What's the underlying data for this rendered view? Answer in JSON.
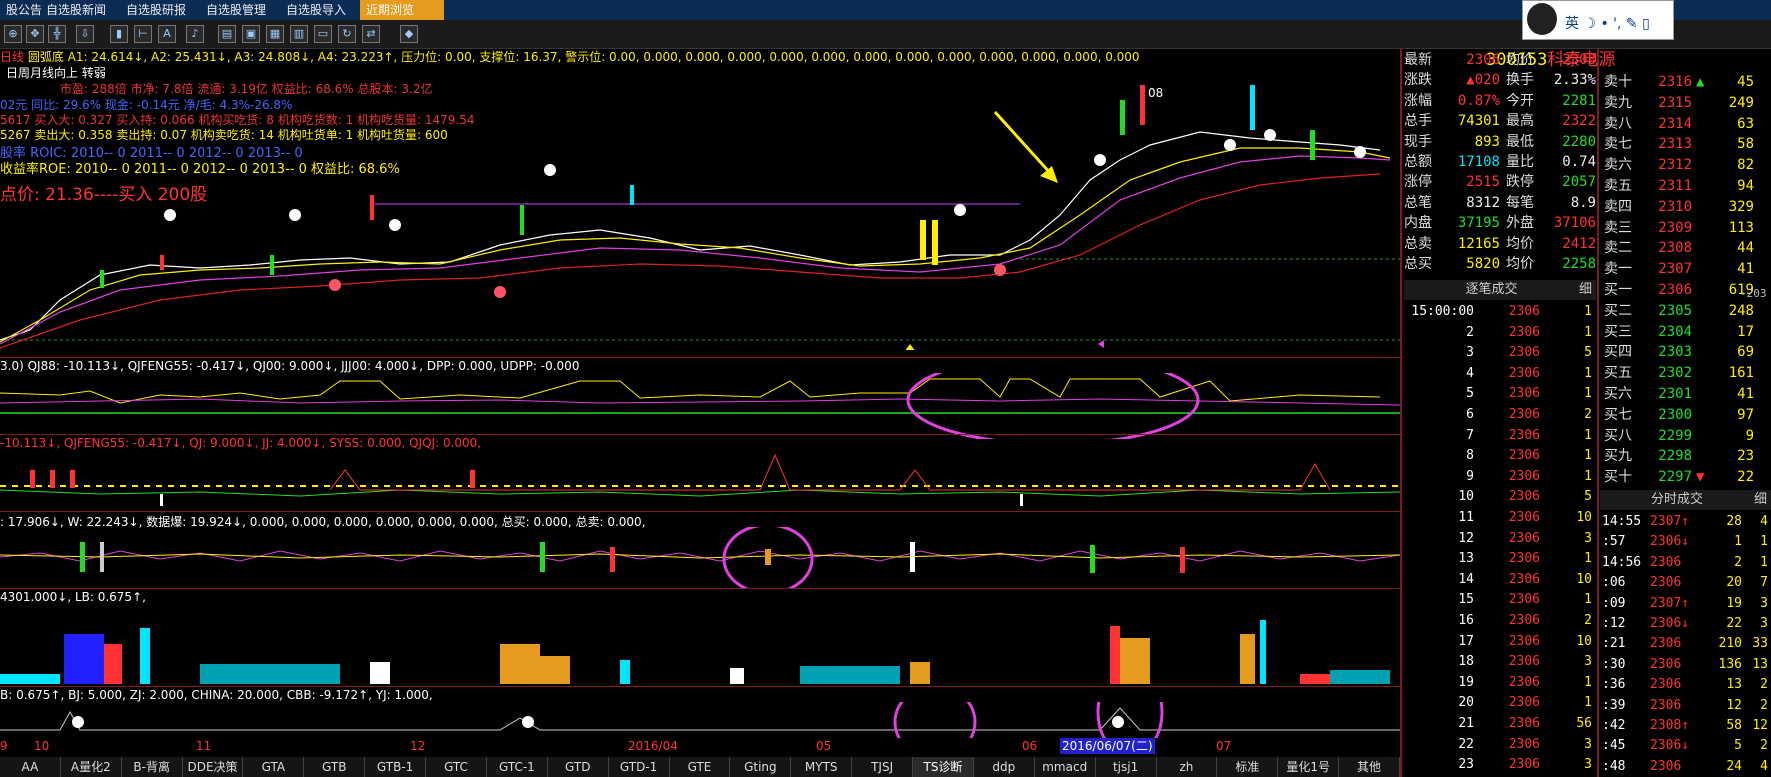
{
  "top_tabs": [
    "股公告",
    "自选股新闻",
    "自选股研报",
    "自选股管理",
    "自选股导入",
    "近期浏览"
  ],
  "chart_info": {
    "period": "日线",
    "indicator_line": "圆弧底 A1: 24.614↓, A2: 25.431↓, A3: 24.808↓, A4: 23.223↑, 压力位: 0.00, 支撑位: 16.37, 警示位: 0.00, 0.000, 0.000, 0.000, 0.000, 0.000, 0.000, 0.000, 0.000, 0.000, 0.000, 0.000, 0.000",
    "subtitle": "日周月线向上   转弱",
    "fund_row1": "市盈: 288倍     市净: 7.8倍      流通: 3.19亿       权益比: 68.6%      总股本: 3.2亿",
    "fund_row2": "02元     同比: 29.6%     现金: -0.14元     净/毛: 4.3%-26.8%",
    "fund_row3": "5617      买入大: 0.327    买入持: 0.066    机构买吃货: 8     机构吃货数: 1     机构吃货量: 1479.54",
    "fund_row4": "5267      卖出大: 0.358    卖出持: 0.07     机构卖吃货: 14    机构吐货单: 1     机构吐货量: 600",
    "roic_row": "股率 ROIC: 2010-- 0    2011-- 0    2012-- 0    2013-- 0",
    "roe_row": "收益率ROE: 2010-- 0    2011-- 0    2012-- 0    2013-- 0    权益比: 68.6%",
    "buy_note": "点价: 21.36----买入 200股",
    "label_08": "08"
  },
  "pane2_info": "3.0)  QJ88: -10.113↓, QJFENG55: -0.417↓, QJ00: 9.000↓, JJJ00: 4.000↓, DPP: 0.000, UDPP: -0.000",
  "pane3_info": "-10.113↓, QJFENG55: -0.417↓, QJ: 9.000↓, JJ: 4.000↓, SYSS: 0.000, QJQJ: 0.000,",
  "pane4_info": ": 17.906↓, W: 22.243↓, 数据爆: 19.924↓, 0.000, 0.000, 0.000, 0.000, 0.000, 0.000, 总买: 0.000, 总卖: 0.000,",
  "pane5_info": "4301.000↓, LB: 0.675↑,",
  "pane6_info": "B: 0.675↑, BJ: 5.000, ZJ: 2.000, CHINA: 20.000, CBB: -9.172↑, YJ: 1.000,",
  "date_axis": [
    "9",
    "10",
    "11",
    "12",
    "2016/04",
    "05",
    "06",
    "2016/06/07(二)",
    "07"
  ],
  "bottom_tabs": [
    "AA",
    "A量化2",
    "B-背离",
    "DDE决策",
    "GTA",
    "GTB",
    "GTB-1",
    "GTC",
    "GTC-1",
    "GTD",
    "GTD-1",
    "GTE",
    "Gting",
    "MYTS",
    "TJSJ",
    "TS诊断",
    "ddp",
    "mmacd",
    "tjsj1",
    "zh",
    "标准",
    "量化1号",
    "其他"
  ],
  "stock": {
    "code": "300153",
    "name": "科泰电源"
  },
  "quote_left": [
    {
      "k": "最新",
      "v": "2306",
      "c": "red"
    },
    {
      "k": "涨跌",
      "v": "▲020",
      "c": "red"
    },
    {
      "k": "涨幅",
      "v": "0.87%",
      "c": "red"
    },
    {
      "k": "总手",
      "v": "74301",
      "c": "yellow"
    },
    {
      "k": "现手",
      "v": "893",
      "c": "yellow"
    },
    {
      "k": "总额",
      "v": "17108",
      "c": "cyan"
    },
    {
      "k": "涨停",
      "v": "2515",
      "c": "red"
    },
    {
      "k": "总笔",
      "v": "8312",
      "c": "white"
    },
    {
      "k": "内盘",
      "v": "37195",
      "c": "green"
    },
    {
      "k": "总卖",
      "v": "12165",
      "c": "yellow"
    },
    {
      "k": "总买",
      "v": "5820",
      "c": "yellow"
    }
  ],
  "quote_right": [
    {
      "k": "均价",
      "v": "2303",
      "c": "red"
    },
    {
      "k": "换手",
      "v": "2.33%",
      "c": "white"
    },
    {
      "k": "今开",
      "v": "2281",
      "c": "green"
    },
    {
      "k": "最高",
      "v": "2322",
      "c": "red"
    },
    {
      "k": "最低",
      "v": "2280",
      "c": "green"
    },
    {
      "k": "量比",
      "v": "0.74",
      "c": "white"
    },
    {
      "k": "跌停",
      "v": "2057",
      "c": "green"
    },
    {
      "k": "每笔",
      "v": "8.9",
      "c": "white"
    },
    {
      "k": "外盘",
      "v": "37106",
      "c": "red"
    },
    {
      "k": "均价",
      "v": "2412",
      "c": "red"
    },
    {
      "k": "均价",
      "v": "2258",
      "c": "green"
    }
  ],
  "order_book": [
    {
      "k": "卖十",
      "p": "2316",
      "m": "▲",
      "v": "45"
    },
    {
      "k": "卖九",
      "p": "2315",
      "m": "",
      "v": "249"
    },
    {
      "k": "卖八",
      "p": "2314",
      "m": "",
      "v": "63"
    },
    {
      "k": "卖七",
      "p": "2313",
      "m": "",
      "v": "58"
    },
    {
      "k": "卖六",
      "p": "2312",
      "m": "",
      "v": "82"
    },
    {
      "k": "卖五",
      "p": "2311",
      "m": "",
      "v": "94"
    },
    {
      "k": "卖四",
      "p": "2310",
      "m": "",
      "v": "329"
    },
    {
      "k": "卖三",
      "p": "2309",
      "m": "",
      "v": "113"
    },
    {
      "k": "卖二",
      "p": "2308",
      "m": "",
      "v": "44"
    },
    {
      "k": "卖一",
      "p": "2307",
      "m": "",
      "v": "41"
    },
    {
      "k": "买一",
      "p": "2306",
      "m": "",
      "v": "619"
    },
    {
      "k": "买二",
      "p": "2305",
      "m": "",
      "v": "248"
    },
    {
      "k": "买三",
      "p": "2304",
      "m": "",
      "v": "17"
    },
    {
      "k": "买四",
      "p": "2303",
      "m": "",
      "v": "69"
    },
    {
      "k": "买五",
      "p": "2302",
      "m": "",
      "v": "161"
    },
    {
      "k": "买六",
      "p": "2301",
      "m": "",
      "v": "41"
    },
    {
      "k": "买七",
      "p": "2300",
      "m": "",
      "v": "97"
    },
    {
      "k": "买八",
      "p": "2299",
      "m": "",
      "v": "9"
    },
    {
      "k": "买九",
      "p": "2298",
      "m": "",
      "v": "23"
    },
    {
      "k": "买十",
      "p": "2297",
      "m": "▼",
      "v": "22"
    }
  ],
  "order_book_extra": "-203",
  "panel_left_header": "逐笔成交",
  "panel_left_tab": "细",
  "panel_right_header": "分时成交",
  "panel_right_tab": "细",
  "ticks_left": [
    {
      "t": "15:00:00",
      "p": "2306",
      "v": "1"
    },
    {
      "t": "2",
      "p": "2306",
      "v": "1"
    },
    {
      "t": "3",
      "p": "2306",
      "v": "5"
    },
    {
      "t": "4",
      "p": "2306",
      "v": "1"
    },
    {
      "t": "5",
      "p": "2306",
      "v": "1"
    },
    {
      "t": "6",
      "p": "2306",
      "v": "2"
    },
    {
      "t": "7",
      "p": "2306",
      "v": "1"
    },
    {
      "t": "8",
      "p": "2306",
      "v": "1"
    },
    {
      "t": "9",
      "p": "2306",
      "v": "1"
    },
    {
      "t": "10",
      "p": "2306",
      "v": "5"
    },
    {
      "t": "11",
      "p": "2306",
      "v": "10"
    },
    {
      "t": "12",
      "p": "2306",
      "v": "3"
    },
    {
      "t": "13",
      "p": "2306",
      "v": "1"
    },
    {
      "t": "14",
      "p": "2306",
      "v": "10"
    },
    {
      "t": "15",
      "p": "2306",
      "v": "1"
    },
    {
      "t": "16",
      "p": "2306",
      "v": "2"
    },
    {
      "t": "17",
      "p": "2306",
      "v": "10"
    },
    {
      "t": "18",
      "p": "2306",
      "v": "3"
    },
    {
      "t": "19",
      "p": "2306",
      "v": "1"
    },
    {
      "t": "20",
      "p": "2306",
      "v": "1"
    },
    {
      "t": "21",
      "p": "2306",
      "v": "56"
    },
    {
      "t": "22",
      "p": "2306",
      "v": "3"
    },
    {
      "t": "23",
      "p": "2306",
      "v": "3"
    }
  ],
  "ticks_right": [
    {
      "t": "14:55",
      "p": "2307↑",
      "v": "28",
      "x": "4"
    },
    {
      "t": ":57",
      "p": "2306↓",
      "v": "1",
      "x": "1"
    },
    {
      "t": "14:56",
      "p": "2306",
      "v": "2",
      "x": "1"
    },
    {
      "t": ":06",
      "p": "2306",
      "v": "20",
      "x": "7"
    },
    {
      "t": ":09",
      "p": "2307↑",
      "v": "19",
      "x": "3"
    },
    {
      "t": ":12",
      "p": "2306↓",
      "v": "22",
      "x": "3"
    },
    {
      "t": ":21",
      "p": "2306",
      "v": "210",
      "x": "33"
    },
    {
      "t": ":30",
      "p": "2306",
      "v": "136",
      "x": "13"
    },
    {
      "t": ":36",
      "p": "2306",
      "v": "13",
      "x": "2"
    },
    {
      "t": ":39",
      "p": "2306",
      "v": "12",
      "x": "2"
    },
    {
      "t": ":42",
      "p": "2308↑",
      "v": "58",
      "x": "12"
    },
    {
      "t": ":45",
      "p": "2306↓",
      "v": "5",
      "x": "2"
    },
    {
      "t": ":48",
      "p": "2306",
      "v": "24",
      "x": "4"
    }
  ],
  "mascot_label": "英 ☽ • ', ✎ ▯",
  "colors": {
    "up": "#ff3333",
    "down": "#22dd22",
    "accent": "#e59b1e",
    "bg": "#000000"
  }
}
